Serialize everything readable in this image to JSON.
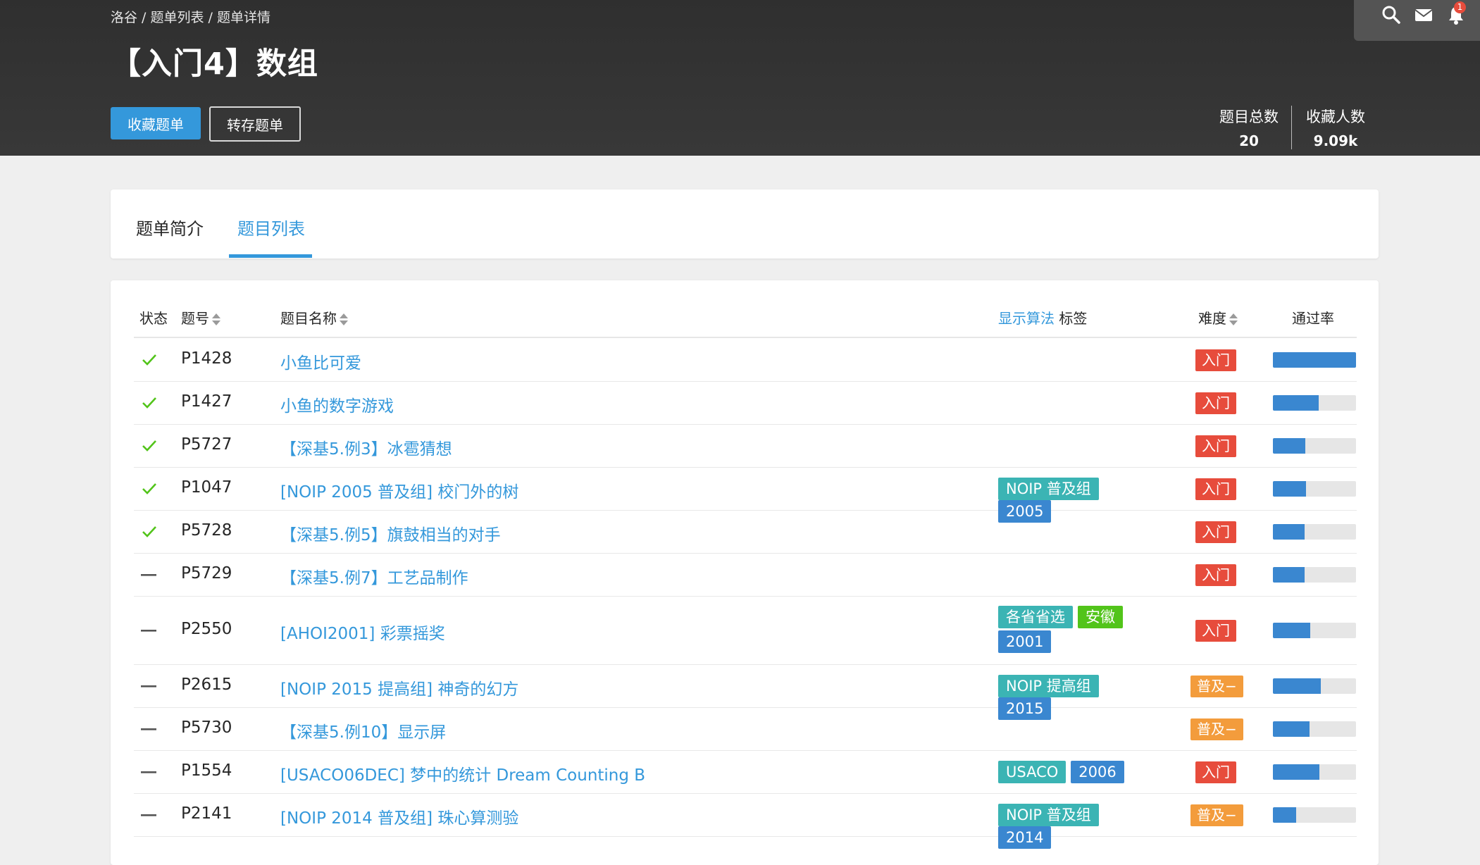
{
  "breadcrumb": [
    "洛谷",
    "题单列表",
    "题单详情"
  ],
  "breadcrumb_sep": " / ",
  "title": "【入门4】数组",
  "buttons": {
    "favorite": "收藏题单",
    "copy": "转存题单"
  },
  "stats": [
    {
      "label": "题目总数",
      "value": "20"
    },
    {
      "label": "收藏人数",
      "value": "9.09k"
    }
  ],
  "topbar": {
    "notification_count": "1"
  },
  "tabs": [
    {
      "label": "题单简介",
      "active": false
    },
    {
      "label": "题目列表",
      "active": true
    }
  ],
  "table": {
    "headers": {
      "status": "状态",
      "pid": "题号",
      "name": "题目名称",
      "tags_toggle": "显示算法",
      "tags": "标签",
      "difficulty": "难度",
      "pass_rate": "通过率"
    },
    "rows": [
      {
        "status": "ac",
        "pid": "P1428",
        "name": "小鱼比可爱",
        "tags": [],
        "difficulty": "入门",
        "pass_rate": 1.0
      },
      {
        "status": "ac",
        "pid": "P1427",
        "name": "小鱼的数字游戏",
        "tags": [],
        "difficulty": "入门",
        "pass_rate": 0.55
      },
      {
        "status": "ac",
        "pid": "P5727",
        "name": "【深基5.例3】冰雹猜想",
        "tags": [],
        "difficulty": "入门",
        "pass_rate": 0.39
      },
      {
        "status": "ac",
        "pid": "P1047",
        "name": "[NOIP 2005 普及组] 校门外的树",
        "tags": [
          {
            "text": "NOIP 普及组",
            "type": "contest"
          },
          {
            "text": "2005",
            "type": "year"
          }
        ],
        "difficulty": "入门",
        "pass_rate": 0.4
      },
      {
        "status": "ac",
        "pid": "P5728",
        "name": "【深基5.例5】旗鼓相当的对手",
        "tags": [],
        "difficulty": "入门",
        "pass_rate": 0.38
      },
      {
        "status": "none",
        "pid": "P5729",
        "name": "【深基5.例7】工艺品制作",
        "tags": [],
        "difficulty": "入门",
        "pass_rate": 0.38
      },
      {
        "status": "none",
        "pid": "P2550",
        "name": "[AHOI2001] 彩票摇奖",
        "tags": [
          {
            "text": "各省省选",
            "type": "contest"
          },
          {
            "text": "安徽",
            "type": "region"
          },
          {
            "text": "2001",
            "type": "year"
          }
        ],
        "difficulty": "入门",
        "pass_rate": 0.45
      },
      {
        "status": "none",
        "pid": "P2615",
        "name": "[NOIP 2015 提高组] 神奇的幻方",
        "tags": [
          {
            "text": "NOIP 提高组",
            "type": "contest"
          },
          {
            "text": "2015",
            "type": "year"
          }
        ],
        "difficulty": "普及−",
        "pass_rate": 0.58
      },
      {
        "status": "none",
        "pid": "P5730",
        "name": "【深基5.例10】显示屏",
        "tags": [],
        "difficulty": "普及−",
        "pass_rate": 0.44
      },
      {
        "status": "none",
        "pid": "P1554",
        "name": "[USACO06DEC] 梦中的统计 Dream Counting B",
        "tags": [
          {
            "text": "USACO",
            "type": "contest"
          },
          {
            "text": "2006",
            "type": "year"
          }
        ],
        "difficulty": "入门",
        "pass_rate": 0.56
      },
      {
        "status": "none",
        "pid": "P2141",
        "name": "[NOIP 2014 普及组] 珠心算测验",
        "tags": [
          {
            "text": "NOIP 普及组",
            "type": "contest"
          },
          {
            "text": "2014",
            "type": "year"
          }
        ],
        "difficulty": "普及−",
        "pass_rate": 0.28
      }
    ]
  },
  "colors": {
    "accent": "#3498db",
    "ac": "#52c41a",
    "tag_contest": "#3bb4b4",
    "tag_year": "#3a87d0",
    "tag_region": "#52c41a",
    "diff_entry": "#e74c3c",
    "diff_popular_minus": "#f39c3c",
    "pass_fill": "#3a87d0"
  }
}
